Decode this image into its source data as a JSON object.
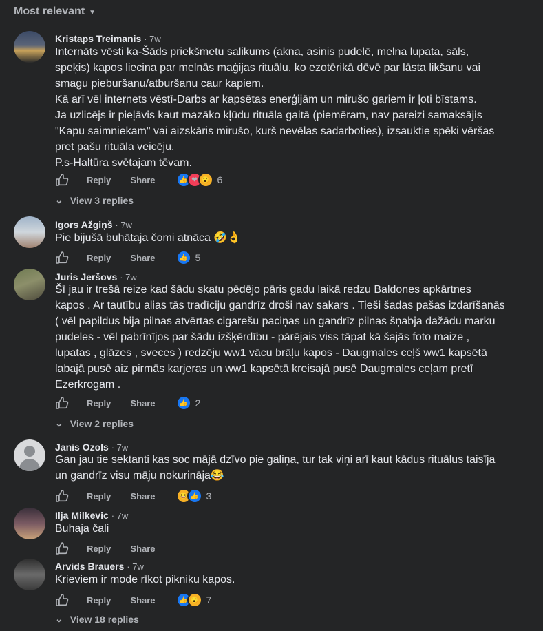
{
  "sort_label": "Most relevant",
  "labels": {
    "reply": "Reply",
    "share": "Share"
  },
  "comments": [
    {
      "author": "Kristaps Treimanis",
      "time": "· 7w",
      "text": "Internāts vēsti ka-Šāds priekšmetu salikums (akna, asinis pudelē, melna lupata, sāls,\nspeķis) kapos liecina par melnās maģijas rituālu, ko ezotērikā dēvē par lāsta likšanu vai\nsmagu pieburšanu/atburšanu caur kapiem.\nKā arī vēl internets vēstī-Darbs ar kapsētas enerģijām un mirušo gariem ir ļoti bīstams.\nJa uzlicējs ir pieļāvis kaut mazāko kļūdu rituāla gaitā (piemēram, nav pareizi samaksājis\n\"Kapu saimniekam\" vai aizskāris mirušo, kurš nevēlas sadarboties), izsauktie spēki vēršas\npret pašu rituāla veicēju.\nP.s-Haltūra svētajam tēvam.",
      "reaction_icons": [
        "like",
        "love",
        "wow"
      ],
      "reaction_count": "6",
      "replies_label": "View 3 replies"
    },
    {
      "author": "Igors Ažgiņš",
      "time": "· 7w",
      "text": "Pie bijušā buhātaja čomi atnāca",
      "reaction_icons": [
        "like"
      ],
      "reaction_count": "5"
    },
    {
      "author": "Juris Jeršovs",
      "time": "· 7w",
      "text": "Šī jau ir trešā reize kad šādu skatu pēdējo pāris gadu laikā redzu Baldones apkārtnes\nkapos . Ar tautību alias tās tradīciju gandrīz droši nav sakars . Tieši šadas pašas izdarīšanās\n( vēl papildus bija pilnas atvērtas cigarešu paciņas un gandrīz pilnas šņabja dažādu marku\npudeles - vēl pabrīnījos par šādu izšķērdību - pārējais viss tāpat kā šajās foto maize ,\nlupatas , glāzes , sveces ) redzēju ww1 vācu brāļu kapos - Daugmales ceļš ww1 kapsētā\nlabajā pusē aiz pirmās karjeras un ww1 kapsētā kreisajā pusē Daugmales ceļam pretī\nEzerkrogam .",
      "reaction_icons": [
        "like"
      ],
      "reaction_count": "2",
      "replies_label": "View 2 replies"
    },
    {
      "author": "Janis Ozols",
      "time": "· 7w",
      "text": "Gan jau tie sektanti kas soc mājā dzīvo pie galiņa, tur tak viņi arī kaut kādus rituālus taisīja\nun gandrīz visu māju nokurināja",
      "reaction_icons": [
        "haha",
        "like"
      ],
      "reaction_count": "3"
    },
    {
      "author": "Ilja Milkevic",
      "time": "· 7w",
      "text": "Buhaja čali"
    },
    {
      "author": "Arvids Brauers",
      "time": "· 7w",
      "text": "Krieviem ir mode rīkot pikniku kapos.",
      "reaction_icons": [
        "like",
        "wow"
      ],
      "reaction_count": "7",
      "replies_label": "View 18 replies"
    }
  ]
}
